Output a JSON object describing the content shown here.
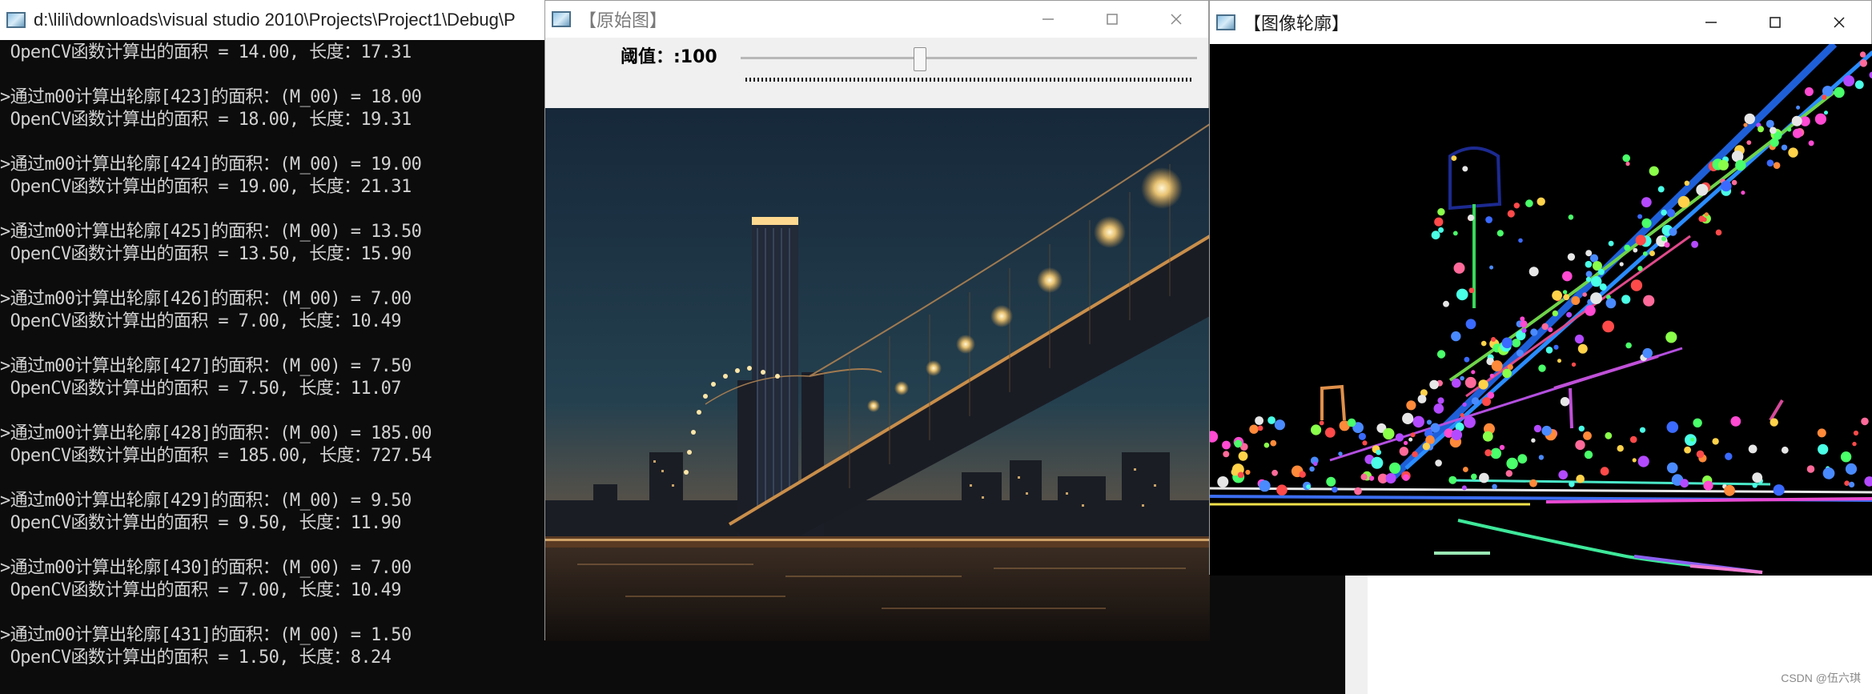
{
  "console": {
    "title": "d:\\lili\\downloads\\visual studio 2010\\Projects\\Project1\\Debug\\P",
    "lines": [
      {
        "text": " OpenCV函数计算出的面积 = 14.00, 长度：17.31"
      },
      {
        "text": ""
      },
      {
        "text": ">通过m00计算出轮廓[423]的面积：(M_00) = 18.00"
      },
      {
        "text": " OpenCV函数计算出的面积 = 18.00, 长度：19.31"
      },
      {
        "text": ""
      },
      {
        "text": ">通过m00计算出轮廓[424]的面积：(M_00) = 19.00"
      },
      {
        "text": " OpenCV函数计算出的面积 = 19.00, 长度：21.31"
      },
      {
        "text": ""
      },
      {
        "text": ">通过m00计算出轮廓[425]的面积：(M_00) = 13.50"
      },
      {
        "text": " OpenCV函数计算出的面积 = 13.50, 长度：15.90"
      },
      {
        "text": ""
      },
      {
        "text": ">通过m00计算出轮廓[426]的面积：(M_00) = 7.00"
      },
      {
        "text": " OpenCV函数计算出的面积 = 7.00, 长度：10.49"
      },
      {
        "text": ""
      },
      {
        "text": ">通过m00计算出轮廓[427]的面积：(M_00) = 7.50"
      },
      {
        "text": " OpenCV函数计算出的面积 = 7.50, 长度：11.07"
      },
      {
        "text": ""
      },
      {
        "text": ">通过m00计算出轮廓[428]的面积：(M_00) = 185.00"
      },
      {
        "text": " OpenCV函数计算出的面积 = 185.00, 长度：727.54"
      },
      {
        "text": ""
      },
      {
        "text": ">通过m00计算出轮廓[429]的面积：(M_00) = 9.50"
      },
      {
        "text": " OpenCV函数计算出的面积 = 9.50, 长度：11.90"
      },
      {
        "text": ""
      },
      {
        "text": ">通过m00计算出轮廓[430]的面积：(M_00) = 7.00"
      },
      {
        "text": " OpenCV函数计算出的面积 = 7.00, 长度：10.49"
      },
      {
        "text": ""
      },
      {
        "text": ">通过m00计算出轮廓[431]的面积：(M_00) = 1.50"
      },
      {
        "text": " OpenCV函数计算出的面积 = 1.50, 长度：8.24"
      }
    ]
  },
  "original_window": {
    "title": "【原始图】",
    "minimize": "—",
    "maximize": "☐",
    "close": "✕",
    "threshold_label": "阈值：:100",
    "threshold_value": 100
  },
  "contour_window": {
    "title": "【图像轮廓】",
    "minimize": "—",
    "maximize": "☐",
    "close": "✕"
  },
  "watermark": "CSDN @伍六琪",
  "colors": {
    "console_bg": "#0c0c0c",
    "console_text": "#d2d2d2",
    "window_bg": "#f0f0f0",
    "contour_bg": "#000000"
  },
  "icons": {
    "app_icon": "window-app-icon",
    "minimize": "minimize-icon",
    "maximize": "maximize-icon",
    "close": "close-icon"
  }
}
